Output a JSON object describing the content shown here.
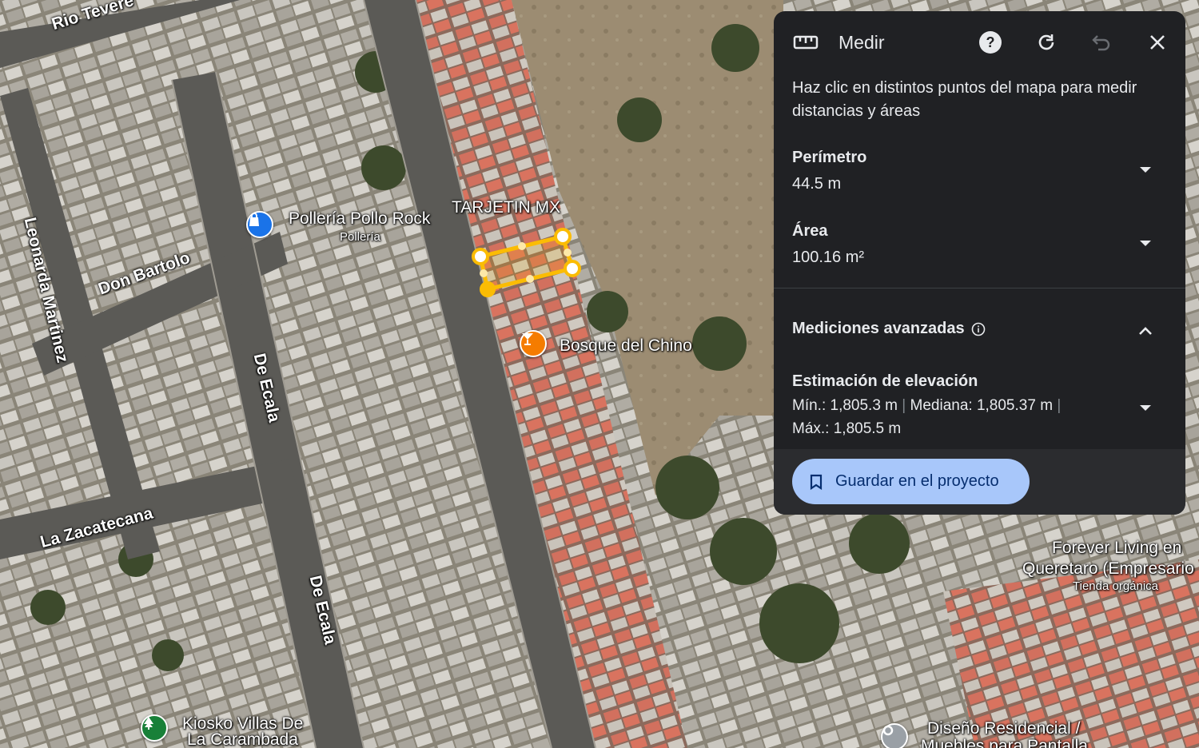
{
  "map": {
    "streets": [
      {
        "id": "rio-tevere",
        "text": "Rio Tevere"
      },
      {
        "id": "don-bartolo",
        "text": "Don Bartolo"
      },
      {
        "id": "leonarda-martinez",
        "text": "Leonarda Martinez"
      },
      {
        "id": "de-ecala-1",
        "text": "De Ecala"
      },
      {
        "id": "de-ecala-2",
        "text": "De Ecala"
      },
      {
        "id": "la-zacatecana",
        "text": "La Zacatecana"
      }
    ],
    "places": {
      "polleria": {
        "name": "Pollería Pollo Rock",
        "category": "Pollería",
        "icon": "shopping-bag-icon",
        "color": "#1a73e8"
      },
      "tarjetin": {
        "name": "TARJETIN MX"
      },
      "bosque": {
        "name": "Bosque del Chino",
        "icon": "cocktail-icon",
        "color": "#f57c00"
      },
      "forever": {
        "name_line1": "Forever Living en",
        "name_line2": "Queretaro (Empresario",
        "category": "Tienda orgánica"
      },
      "kiosko": {
        "name_line1": "Kiosko Villas De",
        "name_line2": "La Carambada",
        "icon": "tree-icon",
        "color": "#188038"
      },
      "diseno": {
        "name_line1": "Diseño Residencial /",
        "name_line2": "Muebles para Pantalla"
      }
    },
    "measure_color": "#fbbc04"
  },
  "panel": {
    "title": "Medir",
    "header_icons": [
      "ruler-icon",
      "help-icon",
      "reset-icon",
      "undo-icon",
      "close-icon"
    ],
    "instruction": "Haz clic en distintos puntos del mapa para medir distancias y áreas",
    "perimeter": {
      "label": "Perímetro",
      "value": "44.5 m"
    },
    "area": {
      "label": "Área",
      "value": "100.16 m²"
    },
    "advanced": {
      "label": "Mediciones avanzadas"
    },
    "elevation": {
      "label": "Estimación de elevación",
      "min": "Mín.: 1,805.3 m",
      "median": "Mediana: 1,805.37 m",
      "max": "Máx.: 1,805.5 m"
    },
    "save_button": "Guardar en el proyecto",
    "colors": {
      "panel_bg": "#202124",
      "button_bg": "#a8c7fa",
      "button_text": "#062e6f"
    }
  }
}
